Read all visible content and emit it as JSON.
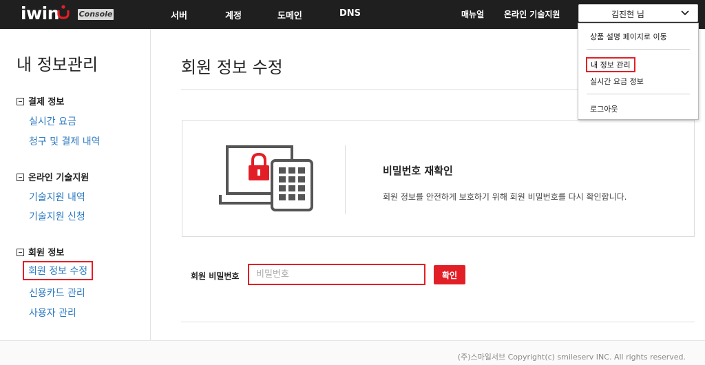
{
  "brand": {
    "logo": "iwin",
    "badge": "Console",
    "accent": "#e21f26"
  },
  "nav": {
    "items": [
      "서버",
      "계정",
      "도메인",
      "DNS"
    ]
  },
  "header_right": {
    "manual": "매뉴얼",
    "support": "온라인 기술지원",
    "user": "김진현 님"
  },
  "user_menu": {
    "items": [
      "상품 설명 페이지로 이동",
      "내 정보 관리",
      "실시간 요금 정보",
      "로그아웃"
    ]
  },
  "sidebar": {
    "title": "내 정보관리",
    "groups": [
      {
        "title": "결제 정보",
        "links": [
          "실시간 요금",
          "청구 및 결제 내역"
        ]
      },
      {
        "title": "온라인 기술지원",
        "links": [
          "기술지원 내역",
          "기술지원 신청"
        ]
      },
      {
        "title": "회원 정보",
        "links": [
          "회원 정보 수정",
          "신용카드 관리",
          "사용자 관리"
        ]
      }
    ]
  },
  "main": {
    "title": "회원 정보 수정",
    "info_title": "비밀번호 재확인",
    "info_desc": "회원 정보를 안전하게 보호하기 위해 회원 비밀번호를 다시 확인합니다.",
    "password_label": "회원 비밀번호",
    "password_placeholder": "비밀번호",
    "password_value": "",
    "confirm_label": "확인"
  },
  "footer": {
    "copyright": "(주)스마일서브 Copyright(c) smileserv INC. All rights reserved."
  }
}
